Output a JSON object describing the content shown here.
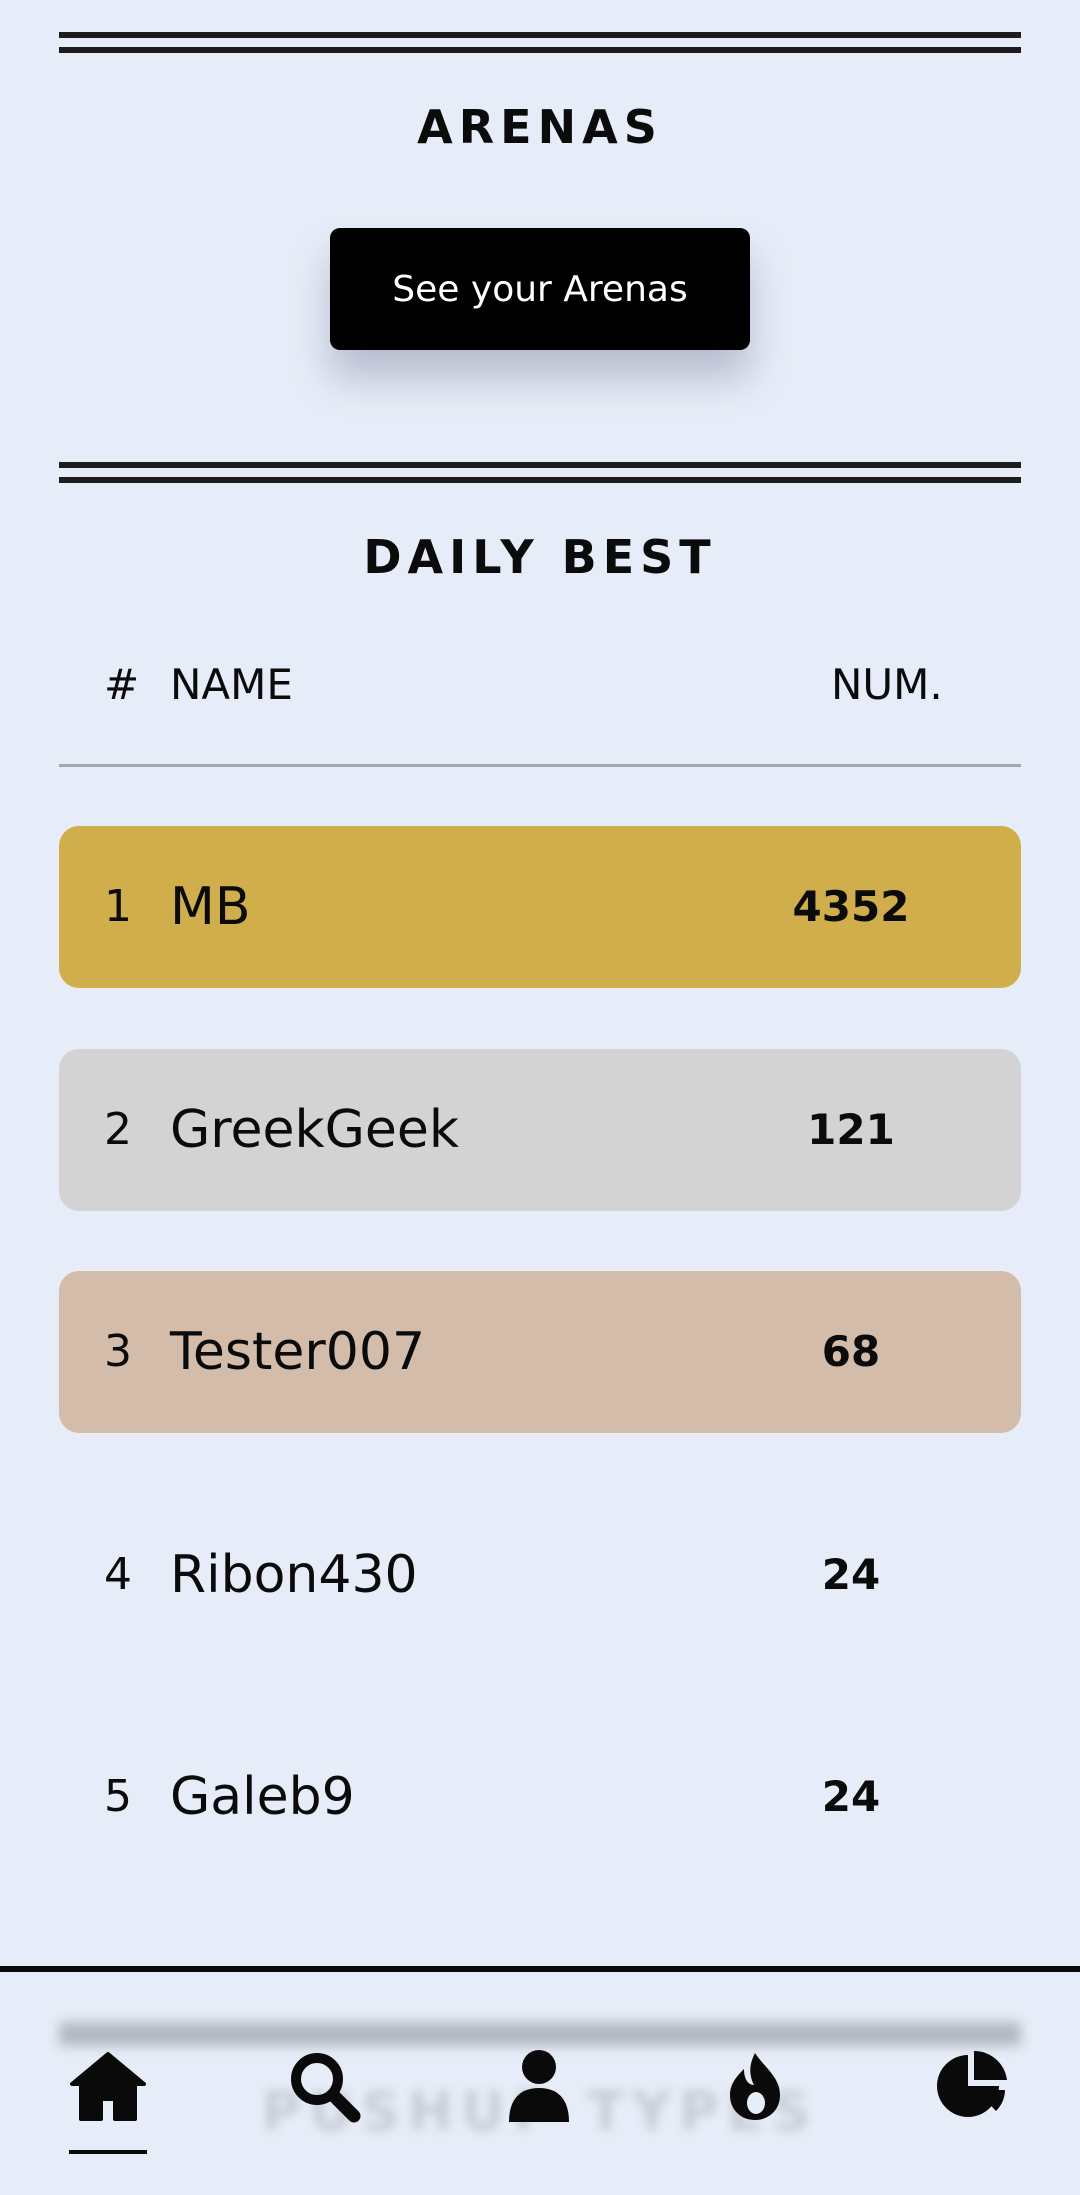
{
  "arenas": {
    "title": "ARENAS",
    "button_label": "See your Arenas"
  },
  "daily_best": {
    "title": "DAILY BEST",
    "columns": {
      "rank": "#",
      "name": "NAME",
      "num": "NUM."
    },
    "rows": [
      {
        "rank": "1",
        "name": "MB",
        "num": "4352",
        "color": "#cfae4b"
      },
      {
        "rank": "2",
        "name": "GreekGeek",
        "num": "121",
        "color": "#d3d3d3"
      },
      {
        "rank": "3",
        "name": "Tester007",
        "num": "68",
        "color": "#d3bdaa"
      },
      {
        "rank": "4",
        "name": "Ribon430",
        "num": "24",
        "color": "transparent"
      },
      {
        "rank": "5",
        "name": "Galeb9",
        "num": "24",
        "color": "transparent"
      }
    ]
  },
  "bottom_nav": {
    "faded_heading": "PUSHUP TYPES",
    "items": [
      {
        "icon": "home-icon",
        "active": true
      },
      {
        "icon": "search-icon",
        "active": false
      },
      {
        "icon": "user-icon",
        "active": false
      },
      {
        "icon": "fire-icon",
        "active": false
      },
      {
        "icon": "pie-chart-icon",
        "active": false
      }
    ]
  }
}
